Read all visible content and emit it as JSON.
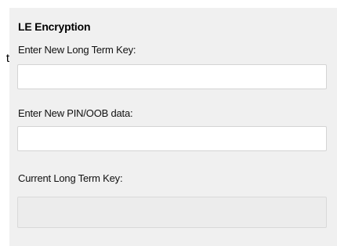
{
  "stray_text": "t",
  "group": {
    "title": "LE Encryption"
  },
  "fields": {
    "new_ltk": {
      "label": "Enter New Long Term Key:",
      "value": ""
    },
    "pin_oob": {
      "label": "Enter New PIN/OOB data:",
      "value": ""
    },
    "current_ltk": {
      "label": "Current Long Term Key:",
      "value": ""
    }
  },
  "colors": {
    "panel_background": "#f0f0f0",
    "textbox_background": "#ffffff",
    "readonly_background": "#ececec",
    "border": "#d4d4d4"
  }
}
